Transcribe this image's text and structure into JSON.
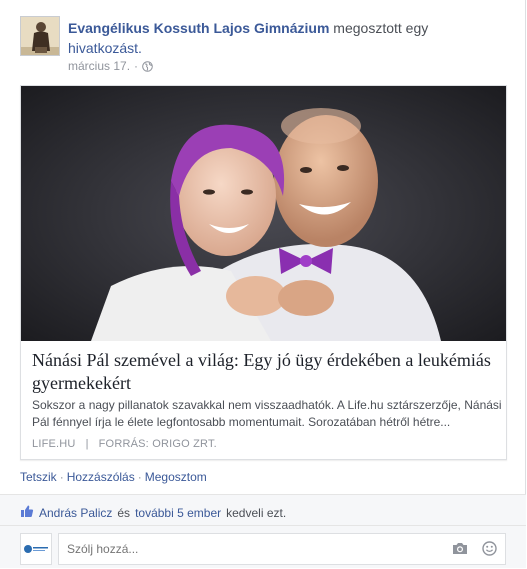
{
  "post": {
    "author": "Evangélikus Kossuth Lajos Gimnázium",
    "action_text": "megosztott egy",
    "action_link": "hivatkozást.",
    "date": "március 17.",
    "separator": "·"
  },
  "preview": {
    "title": "Nánási Pál szemével a világ: Egy jó ügy érdekében a leukémiás gyermekekért",
    "description": "Sokszor a nagy pillanatok szavakkal nem visszaadhatók. A Life.hu sztárszerzője, Nánási Pál fénnyel írja le élete legfontosabb momentumait. Sorozatában hétről hétre...",
    "source": "LIFE.HU",
    "source_sep": "|",
    "credit": "FORRÁS: ORIGO ZRT."
  },
  "actions": {
    "like": "Tetszik",
    "comment": "Hozzászólás",
    "share": "Megosztom",
    "dot": "·"
  },
  "likes": {
    "name": "András Palicz",
    "and": "és",
    "others": "további 5 ember",
    "suffix": "kedveli ezt."
  },
  "comment": {
    "placeholder": "Szólj hozzá..."
  },
  "colors": {
    "link": "#3b5998",
    "muted": "#90949c",
    "feedback_bg": "#f6f7f9"
  },
  "icons": [
    "globe-icon",
    "thumbs-up-icon",
    "camera-icon",
    "smiley-icon"
  ]
}
